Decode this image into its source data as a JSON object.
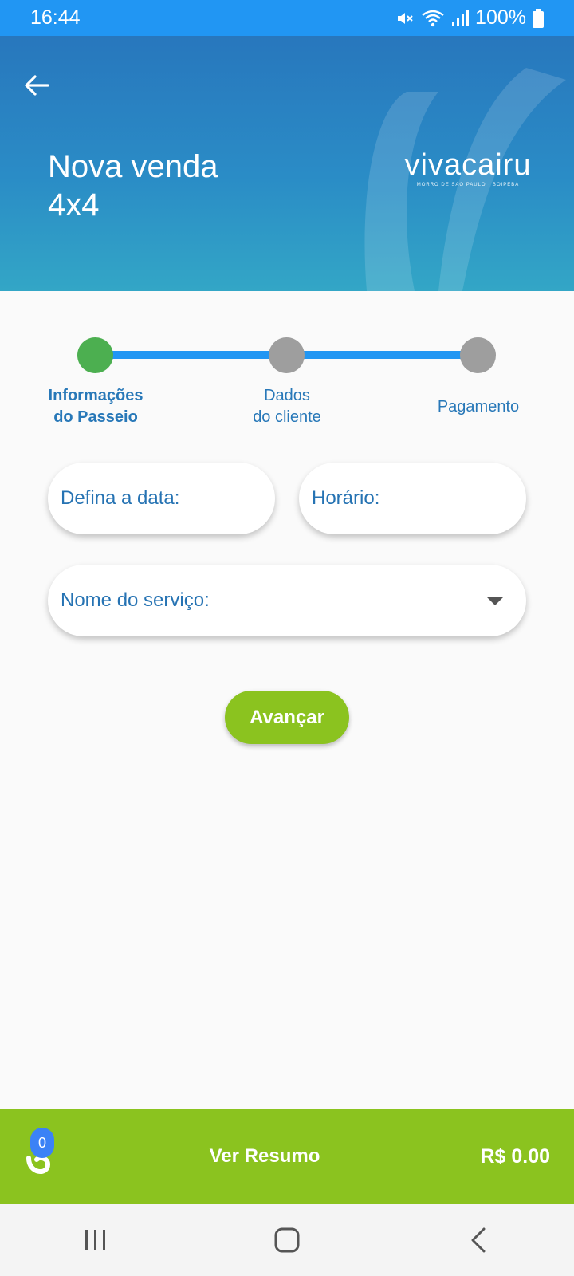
{
  "status": {
    "time": "16:44",
    "battery": "100%"
  },
  "header": {
    "title_line1": "Nova venda",
    "title_line2": "4x4",
    "logo_word": "vivacairu",
    "logo_sub": "MORRO DE SÃO PAULO · BOIPEBA"
  },
  "stepper": {
    "steps": [
      {
        "line1": "Informações",
        "line2": "do Passeio"
      },
      {
        "line1": "Dados",
        "line2": "do cliente"
      },
      {
        "line1": "Pagamento"
      }
    ]
  },
  "form": {
    "date_placeholder": "Defina a data:",
    "time_placeholder": "Horário:",
    "service_placeholder": "Nome do serviço:"
  },
  "actions": {
    "advance_label": "Avançar"
  },
  "cart": {
    "count": "0",
    "summary_label": "Ver Resumo",
    "total": "R$ 0.00"
  },
  "colors": {
    "status_bar": "#2196f3",
    "accent_green": "#8bc31f",
    "step_active": "#4caf50",
    "step_inactive": "#9e9e9e",
    "text_blue": "#2673b3"
  }
}
